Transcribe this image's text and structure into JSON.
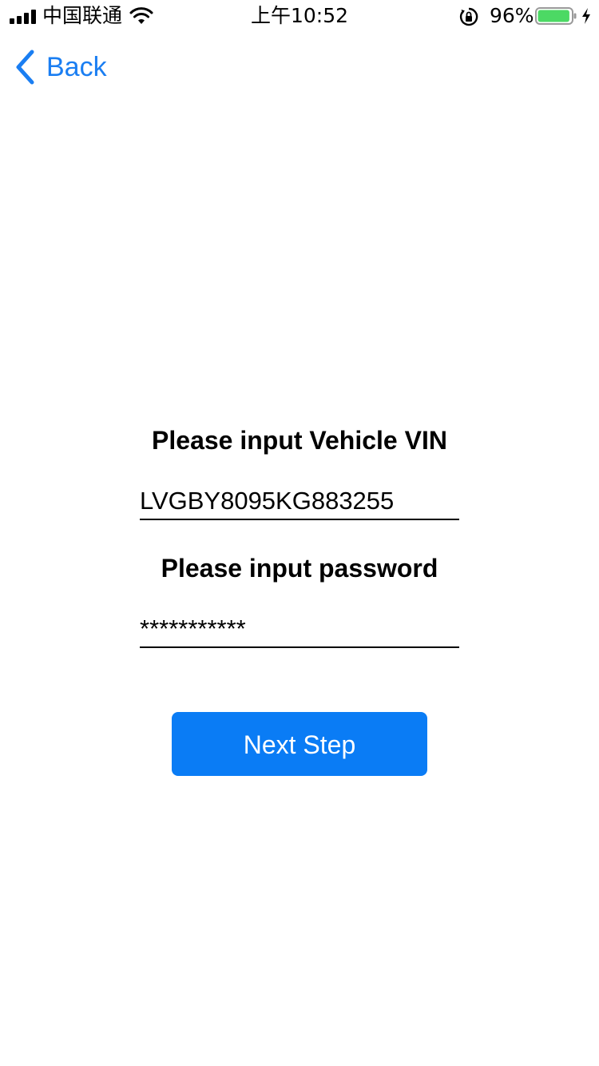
{
  "status_bar": {
    "carrier": "中国联通",
    "time": "上午10:52",
    "battery_percent": "96%",
    "battery_level": 0.96,
    "icons": [
      "signal-icon",
      "wifi-icon",
      "rotation-lock-icon",
      "battery-icon",
      "charging-icon"
    ]
  },
  "nav": {
    "back_label": "Back",
    "back_icon": "chevron-left-icon",
    "accent_color": "#1a7ef2"
  },
  "form": {
    "vin_label": "Please input Vehicle VIN",
    "vin_value": "LVGBY8095KG883255",
    "password_label": "Please input password",
    "password_value": "***********",
    "next_button_label": "Next Step",
    "button_color": "#0a7cf5"
  }
}
